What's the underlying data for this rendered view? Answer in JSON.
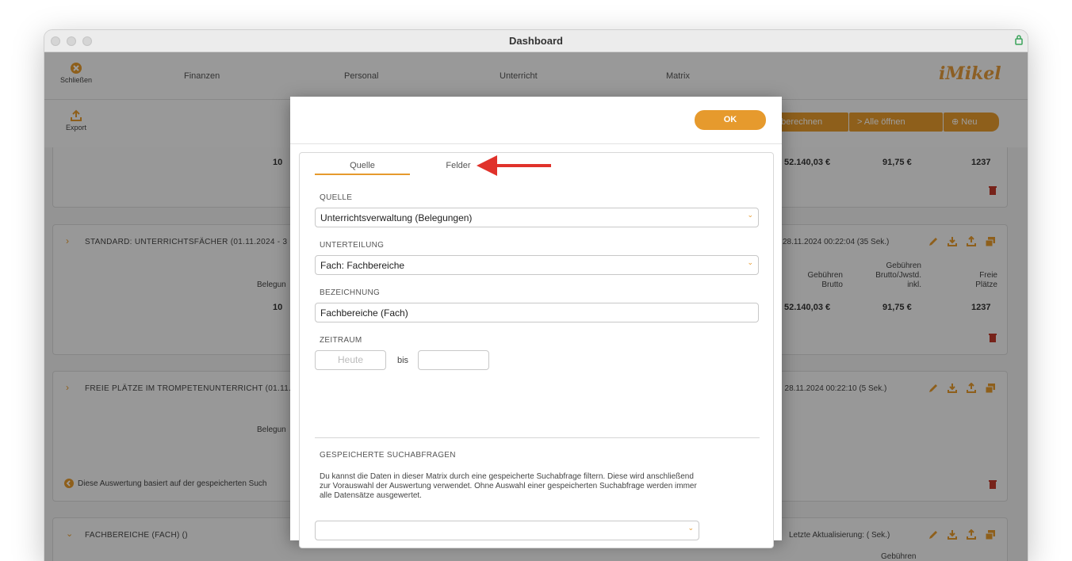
{
  "window": {
    "title": "Dashboard"
  },
  "nav": {
    "close_label": "Schließen",
    "items": [
      "Finanzen",
      "Personal",
      "Unterricht",
      "Matrix"
    ],
    "logo": "iMikel"
  },
  "toolbar": {
    "export_label": "Export",
    "recalc_label": "u berechnen",
    "open_all_label": "> Alle öffnen",
    "new_label": "Neu"
  },
  "panels": {
    "p0": {
      "left_value": "10",
      "brutto": "52.140,03 €",
      "jwstd": "91,75 €",
      "free": "1237"
    },
    "p1": {
      "title": "STANDARD: UNTERRICHTSFÄCHER (01.11.2024 - 3",
      "updated": "28.11.2024 00:22:04  (35 Sek.)",
      "col_left": "Belegun",
      "col_brutto": "Gebühren Brutto",
      "col_jwstd": "Gebühren Brutto/Jwstd. inkl.",
      "col_free": "Freie Plätze",
      "left_value": "10",
      "brutto": "52.140,03 €",
      "jwstd": "91,75 €",
      "free": "1237"
    },
    "p2": {
      "title": "FREIE PLÄTZE IM TROMPETENUNTERRICHT (01.11.",
      "updated": ": 28.11.2024 00:22:10  (5 Sek.)",
      "col_left": "Belegun",
      "note": "Diese Auswertung basiert auf der gespeicherten Such"
    },
    "p3": {
      "title": "FACHBEREICHE (FACH) ()",
      "updated": "Letzte Aktualisierung:  ( Sek.)",
      "col_brutto_partial": "Gebühren"
    }
  },
  "modal": {
    "ok_label": "OK",
    "tabs": [
      "Quelle",
      "Felder"
    ],
    "source_label": "QUELLE",
    "source_value": "Unterrichtsverwaltung (Belegungen)",
    "division_label": "UNTERTEILUNG",
    "division_value": "Fach: Fachbereiche",
    "name_label": "BEZEICHNUNG",
    "name_value": "Fachbereiche (Fach)",
    "period_label": "ZEITRAUM",
    "period_from_placeholder": "Heute",
    "period_sep": "bis",
    "saved_label": "GESPEICHERTE SUCHABFRAGEN",
    "saved_desc": "Du kannst die Daten in dieser Matrix durch eine gespeicherte Suchabfrage filtern. Diese wird anschließend zur Vorauswahl der Auswertung verwendet. Ohne Auswahl einer gespeicherten Suchabfrage werden immer alle Datensätze ausgewertet."
  },
  "colors": {
    "accent": "#e69a2d",
    "danger": "#c0392b",
    "arrow": "#e0322b"
  }
}
